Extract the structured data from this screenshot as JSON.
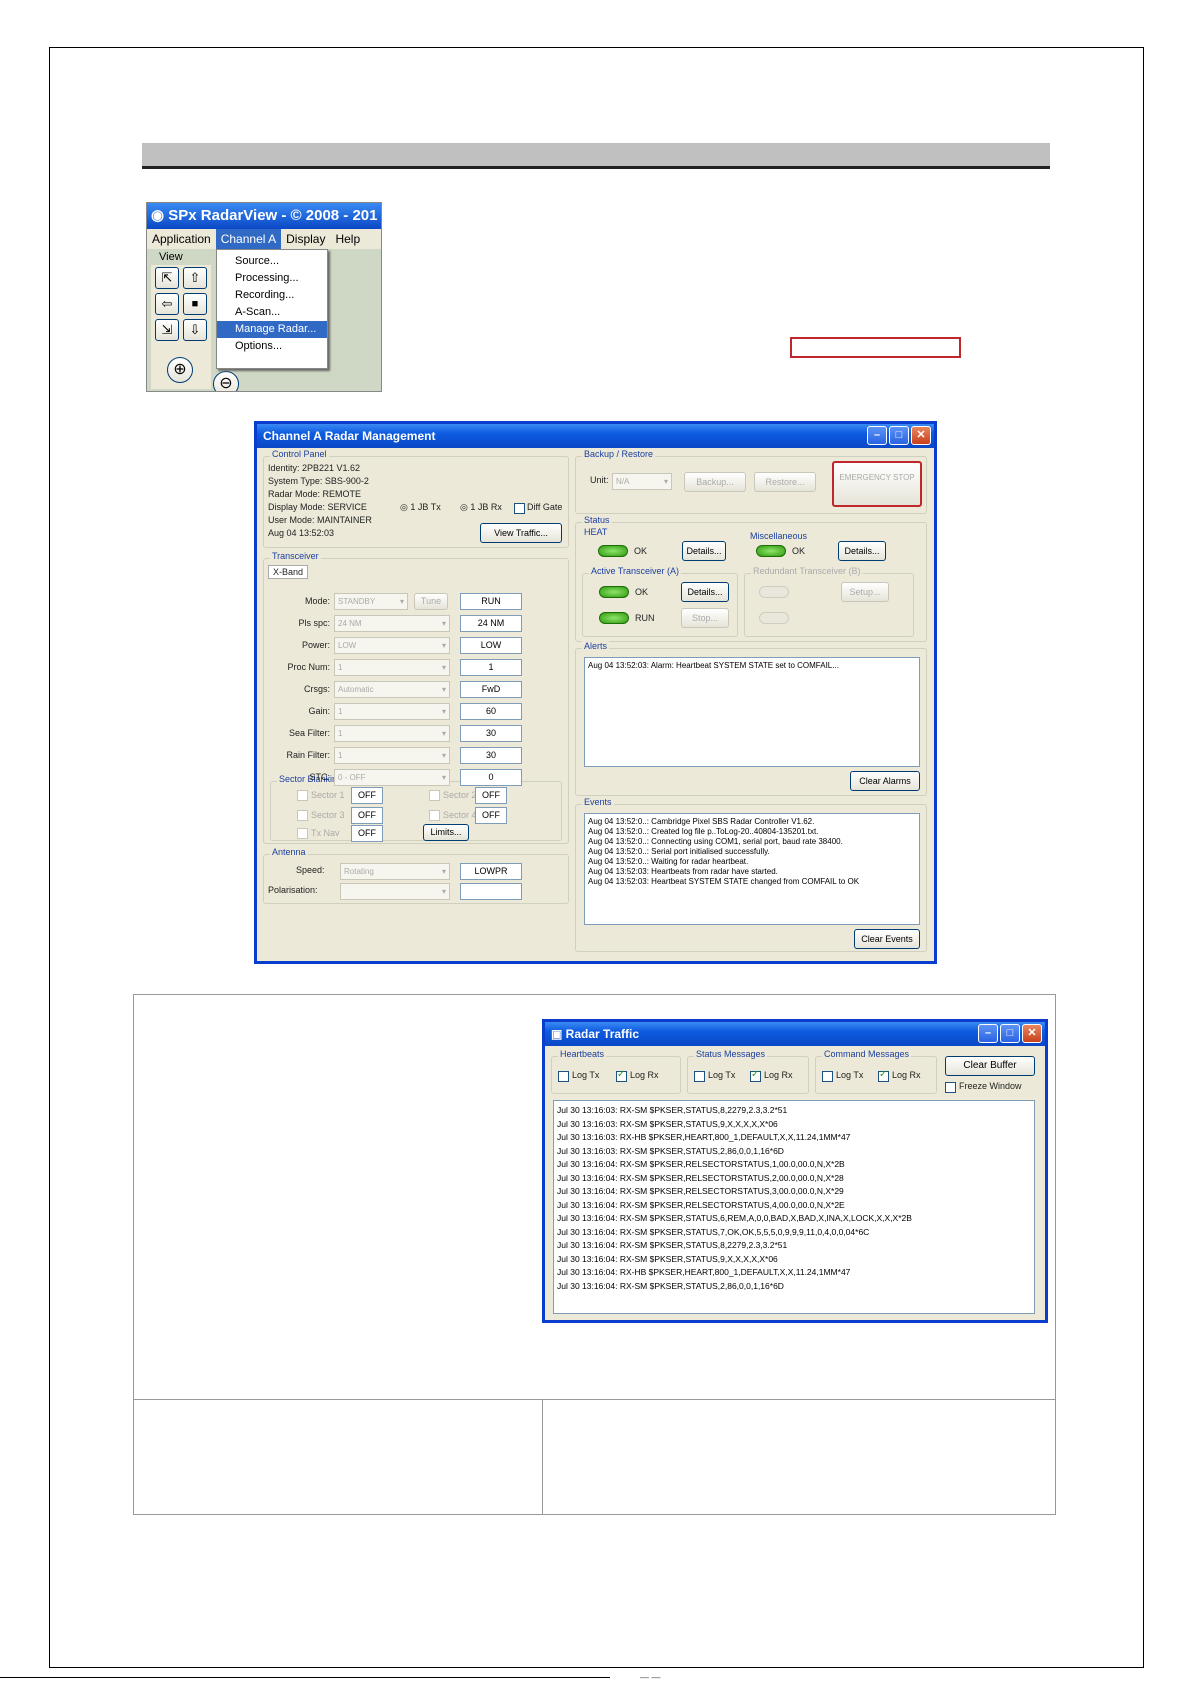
{
  "menu_shot": {
    "title": "SPx RadarView - © 2008 - 201",
    "menubar": [
      "Application",
      "Channel A",
      "Display",
      "Help"
    ],
    "view_label": "View",
    "items": [
      "Source...",
      "Processing...",
      "Recording...",
      "A-Scan...",
      "Manage Radar...",
      "Options..."
    ]
  },
  "mgmt": {
    "title": "Channel A Radar Management",
    "control_panel": {
      "title": "Control Panel",
      "lines": [
        "Identity: 2PB221 V1.62",
        "System Type: SBS-900-2",
        "Radar Mode: REMOTE",
        "Display Mode: SERVICE",
        "User Mode: MAINTAINER",
        "Aug 04 13:52:03"
      ],
      "radio1": "1 JB Tx",
      "radio2": "1 JB Rx",
      "chk": "Diff Gate",
      "view_traffic": "View Traffic..."
    },
    "transceiver": {
      "title": "Transceiver",
      "tab": "X-Band",
      "rows": [
        {
          "label": "Mode:",
          "sel": "STANDBY",
          "value": "RUN"
        },
        {
          "label": "Pls spc:",
          "sel": "24 NM",
          "value": "24 NM"
        },
        {
          "label": "Power:",
          "sel": "LOW",
          "value": "LOW"
        },
        {
          "label": "Proc Num:",
          "sel": "1",
          "value": "1"
        },
        {
          "label": "Crsgs:",
          "sel": "Automatic",
          "value": "FwD"
        },
        {
          "label": "Gain:",
          "sel": "1",
          "value": "60"
        },
        {
          "label": "Sea Filter:",
          "sel": "1",
          "value": "30"
        },
        {
          "label": "Rain Filter:",
          "sel": "1",
          "value": "30"
        },
        {
          "label": "STC:",
          "sel": "0 - OFF",
          "value": "0"
        }
      ],
      "tune": "Tune"
    },
    "sector": {
      "title": "Sector Blanking",
      "items": [
        {
          "label": "Sector 1",
          "value": "OFF"
        },
        {
          "label": "Sector 2",
          "value": "OFF"
        },
        {
          "label": "Sector 3",
          "value": "OFF"
        },
        {
          "label": "Sector 4",
          "value": "OFF"
        },
        {
          "label": "Tx Nav",
          "value": "OFF"
        }
      ],
      "limits": "Limits..."
    },
    "antenna": {
      "title": "Antenna",
      "speed_label": "Speed:",
      "speed_sel": "Rotating",
      "speed_value": "LOWPR",
      "pol_label": "Polarisation:"
    },
    "backup": {
      "title": "Backup / Restore",
      "unit_label": "Unit:",
      "unit_val": "N/A",
      "backup": "Backup...",
      "restore": "Restore...",
      "emergency": "EMERGENCY STOP"
    },
    "status": {
      "title": "Status",
      "heartbeat": "HEAT",
      "hb_ok": "OK",
      "details": "Details...",
      "misc": "Miscellaneous",
      "misc_ok": "OK",
      "active": "Active Transceiver (A)",
      "act_ok": "OK",
      "run": "RUN",
      "stop": "Stop...",
      "redundant": "Redundant Transceiver (B)",
      "setup": "Setup..."
    },
    "alerts": {
      "title": "Alerts",
      "lines": [
        "Aug 04 13:52:03: Alarm: Heartbeat SYSTEM STATE set to COMFAIL..."
      ],
      "clear": "Clear Alarms"
    },
    "events": {
      "title": "Events",
      "lines": [
        "Aug 04 13:52:0..: Cambridge Pixel SBS Radar Controller V1.62.",
        "Aug 04 13:52:0..: Created log file p..ToLog-20..40804-135201.txt.",
        "Aug 04 13:52:0..: Connecting using COM1, serial port, baud rate 38400.",
        "Aug 04 13:52:0..: Serial port initialised successfully.",
        "Aug 04 13:52:0..: Waiting for radar heartbeat.",
        "Aug 04 13:52:03: Heartbeats from radar have started.",
        "Aug 04 13:52:03: Heartbeat SYSTEM STATE changed from COMFAIL to OK"
      ],
      "clear": "Clear Events"
    }
  },
  "traffic": {
    "title": "Radar Traffic",
    "groups": [
      {
        "name": "Heartbeats"
      },
      {
        "name": "Status Messages"
      },
      {
        "name": "Command Messages"
      }
    ],
    "log_tx": "Log Tx",
    "log_rx": "Log Rx",
    "clear_buffer": "Clear Buffer",
    "freeze": "Freeze Window",
    "lines": [
      "Jul 30 13:16:03: RX-SM $PKSER,STATUS,8,2279,2.3,3.2*51",
      "Jul 30 13:16:03: RX-SM $PKSER,STATUS,9,X,X,X,X,X*06",
      "Jul 30 13:16:03: RX-HB $PKSER,HEART,800_1,DEFAULT,X,X,11.24,1MM*47",
      "Jul 30 13:16:03: RX-SM $PKSER,STATUS,2,86,0,0,1,16*6D",
      "Jul 30 13:16:04: RX-SM $PKSER,RELSECTORSTATUS,1,00.0,00.0,N,X*2B",
      "Jul 30 13:16:04: RX-SM $PKSER,RELSECTORSTATUS,2,00.0,00.0,N,X*28",
      "Jul 30 13:16:04: RX-SM $PKSER,RELSECTORSTATUS,3,00.0,00.0,N,X*29",
      "Jul 30 13:16:04: RX-SM $PKSER,RELSECTORSTATUS,4,00.0,00.0,N,X*2E",
      "Jul 30 13:16:04: RX-SM $PKSER,STATUS,6,REM,A,0,0,BAD,X,BAD,X,INA,X,LOCK,X,X,X*2B",
      "Jul 30 13:16:04: RX-SM $PKSER,STATUS,7,OK,OK,5,5,5,0,9,9,9,11,0,4,0,0,04*6C",
      "Jul 30 13:16:04: RX-SM $PKSER,STATUS,8,2279,2.3,3.2*51",
      "Jul 30 13:16:04: RX-SM $PKSER,STATUS,9,X,X,X,X,X*06",
      "Jul 30 13:16:04: RX-HB $PKSER,HEART,800_1,DEFAULT,X,X,11.24,1MM*47",
      "Jul 30 13:16:04: RX-SM $PKSER,STATUS,2,86,0,0,1,16*6D"
    ]
  },
  "footer_mark": "— —"
}
